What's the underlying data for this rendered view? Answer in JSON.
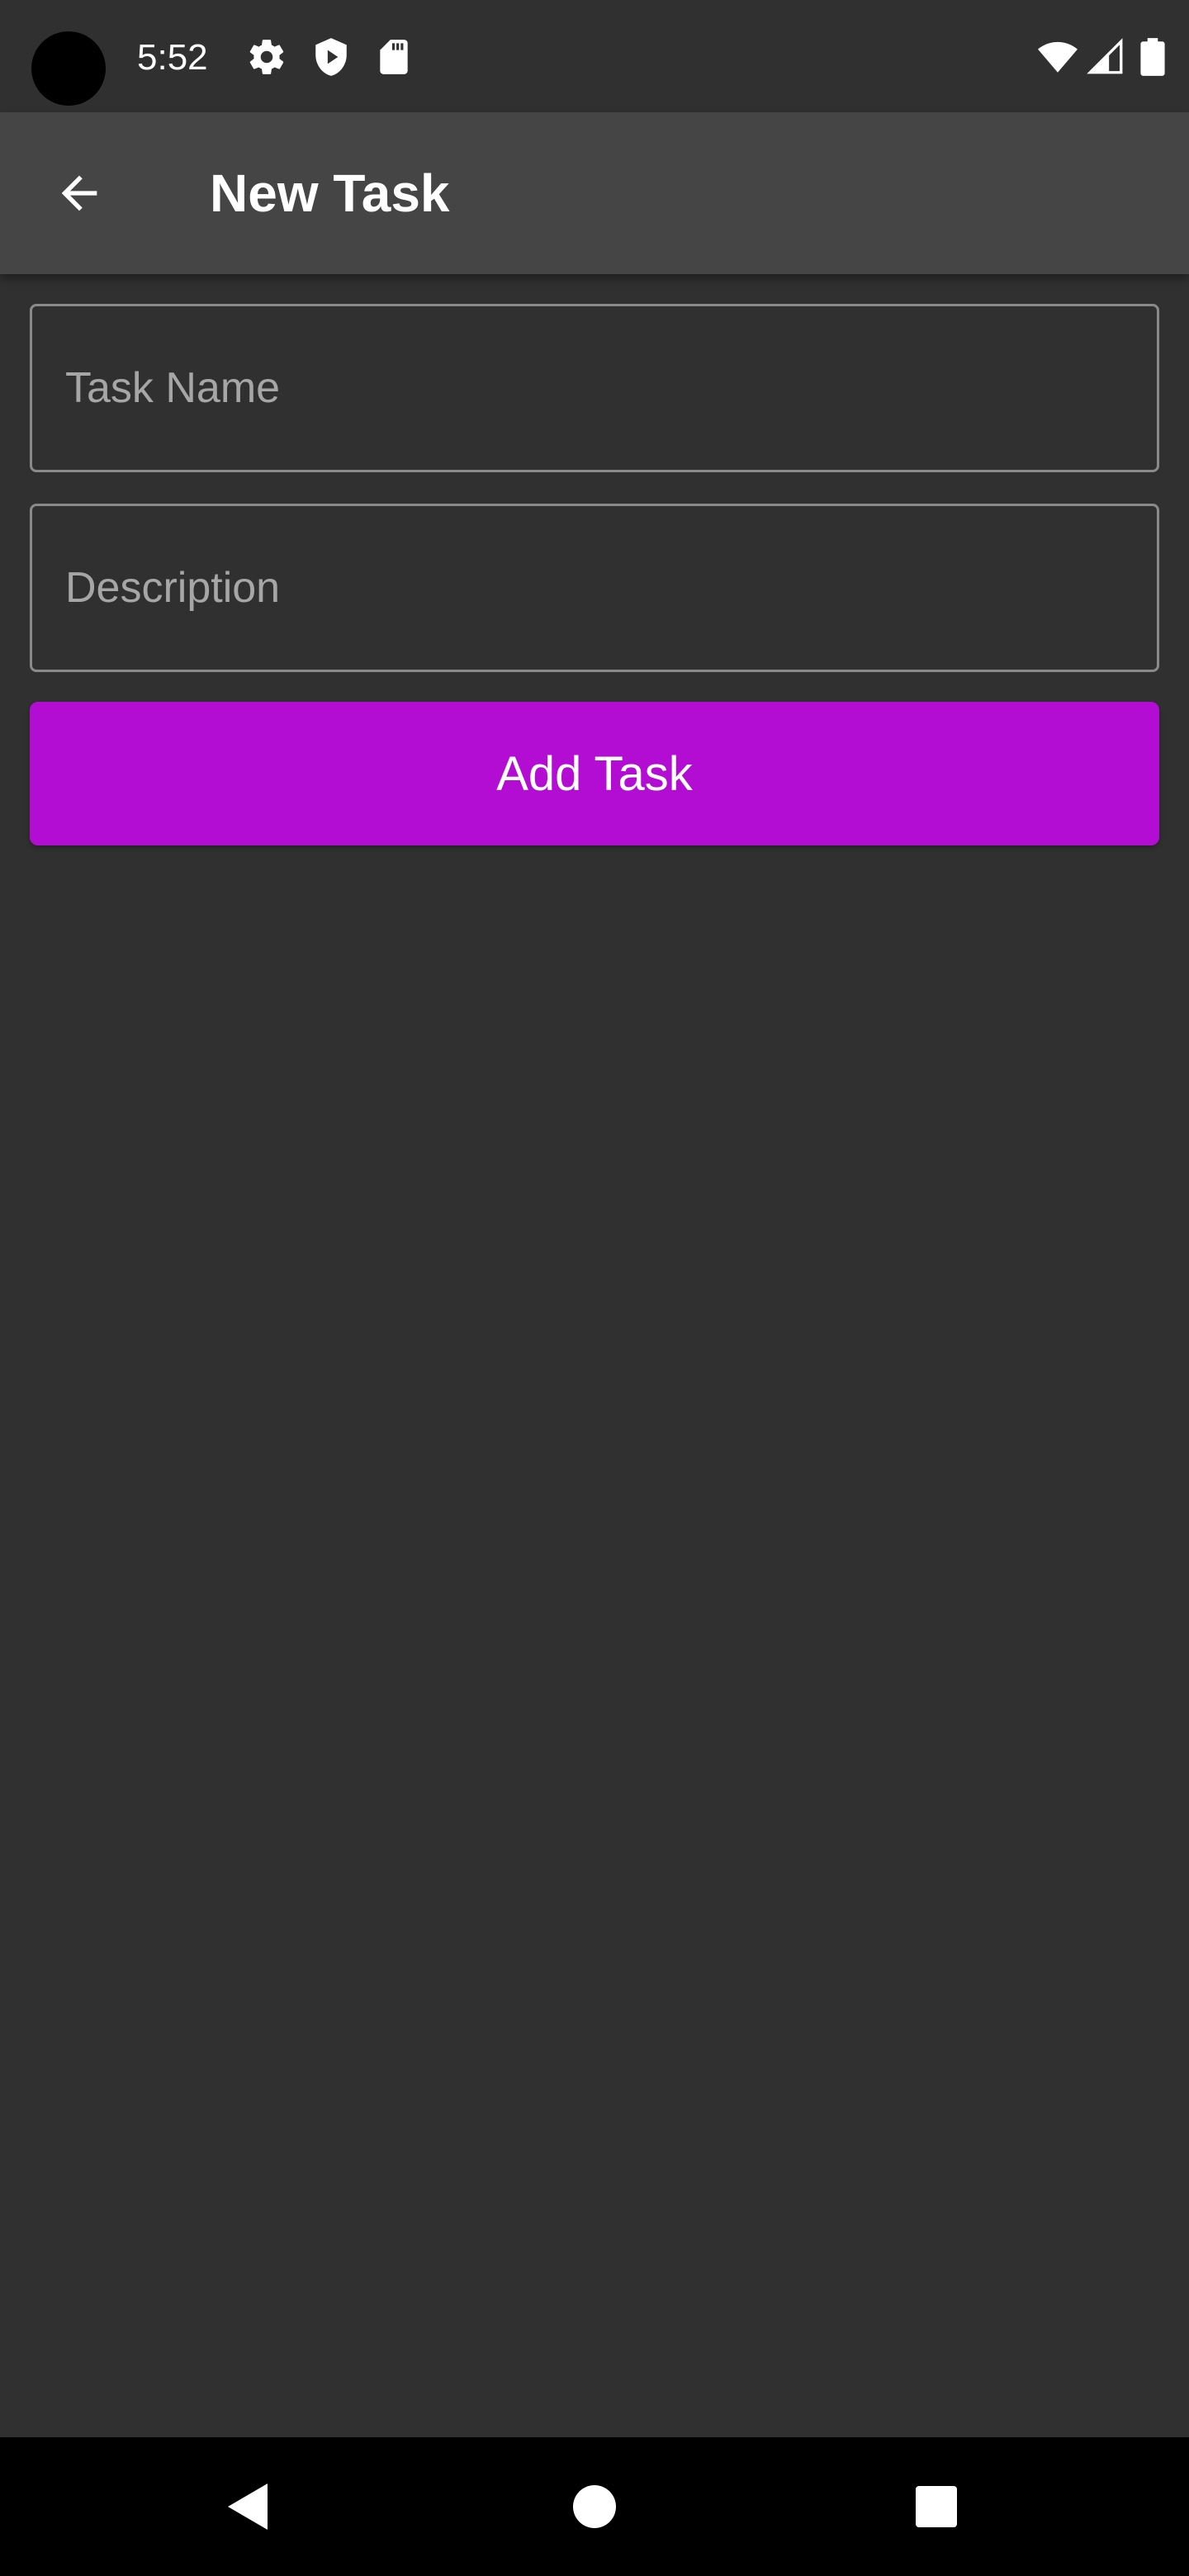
{
  "status_bar": {
    "time": "5:52",
    "icons": [
      "settings-icon",
      "shield-play-icon",
      "sd-card-icon",
      "wifi-icon",
      "cell-signal-icon",
      "battery-icon"
    ]
  },
  "app_bar": {
    "title": "New Task",
    "back_icon": "arrow-back-icon"
  },
  "form": {
    "task_name": {
      "placeholder": "Task Name",
      "value": ""
    },
    "description": {
      "placeholder": "Description",
      "value": ""
    },
    "submit_label": "Add Task"
  },
  "nav_bar": {
    "icons": [
      "nav-back-icon",
      "nav-home-icon",
      "nav-recents-icon"
    ]
  },
  "colors": {
    "background": "#303030",
    "app_bar": "#454545",
    "accent": "#b30dd4",
    "field_border": "#8a8a8a"
  }
}
